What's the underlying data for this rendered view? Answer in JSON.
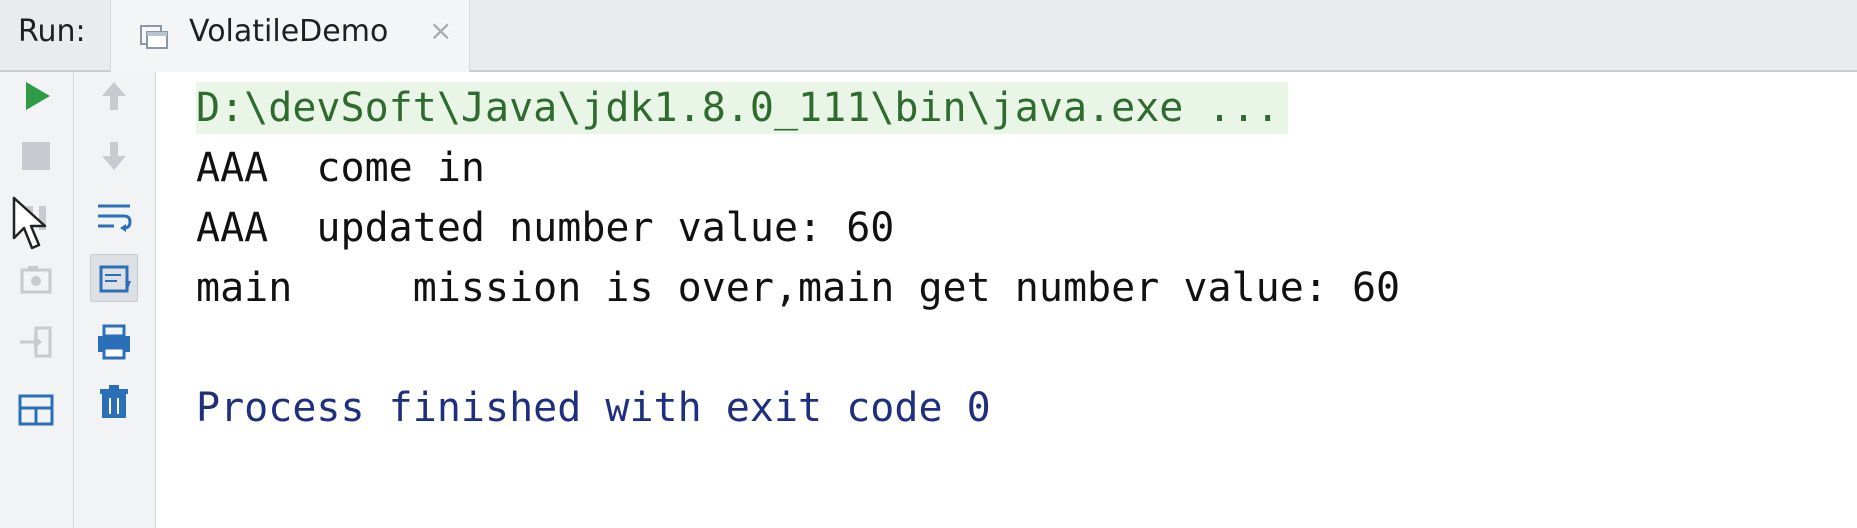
{
  "header": {
    "run_label": "Run:",
    "tab_title": "VolatileDemo",
    "tab_close": "×"
  },
  "toolbar": {
    "left": [
      {
        "name": "rerun-icon"
      },
      {
        "name": "stop-icon"
      },
      {
        "name": "pause-icon"
      },
      {
        "name": "dump-threads-icon"
      },
      {
        "name": "exit-icon"
      },
      {
        "name": "layout-icon"
      }
    ],
    "right": [
      {
        "name": "arrow-up-icon"
      },
      {
        "name": "arrow-down-icon"
      },
      {
        "name": "soft-wrap-icon"
      },
      {
        "name": "scroll-to-end-icon"
      },
      {
        "name": "print-icon"
      },
      {
        "name": "trash-icon"
      }
    ]
  },
  "console": {
    "command_line": "D:\\devSoft\\Java\\jdk1.8.0_111\\bin\\java.exe ...",
    "lines": [
      "AAA  come in",
      "AAA  updated number value: 60",
      "main     mission is over,main get number value: 60",
      "",
      "Process finished with exit code 0"
    ]
  },
  "colors": {
    "command_bg": "#e9f5e6",
    "command_text": "#2f6b2f",
    "exit_text": "#1f2f7f",
    "run_green": "#2f9b45",
    "tool_blue": "#2a6fb8"
  }
}
